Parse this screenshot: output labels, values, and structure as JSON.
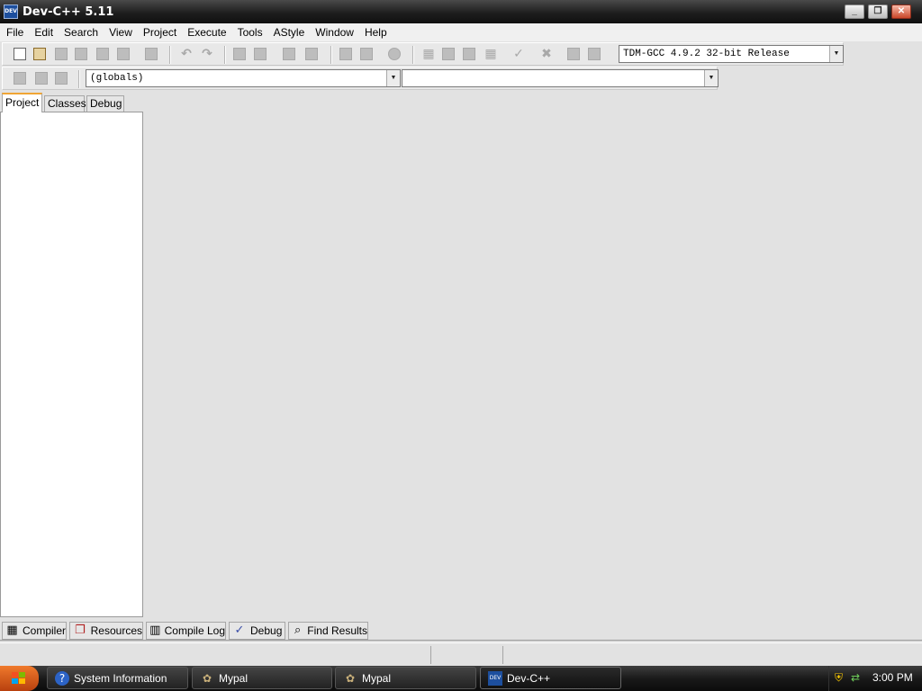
{
  "window": {
    "title": "Dev-C++ 5.11",
    "icon_text": "DEV",
    "controls": {
      "minimize": "_",
      "maximize": "❐",
      "close": "✕"
    }
  },
  "menu": [
    "File",
    "Edit",
    "Search",
    "View",
    "Project",
    "Execute",
    "Tools",
    "AStyle",
    "Window",
    "Help"
  ],
  "toolbar": {
    "compiler_selected": "TDM-GCC 4.9.2 32-bit Release",
    "scope_selected": "(globals)",
    "function_selected": ""
  },
  "project_tabs": [
    "Project",
    "Classes",
    "Debug"
  ],
  "bottom_tabs": [
    "Compiler",
    "Resources",
    "Compile Log",
    "Debug",
    "Find Results"
  ],
  "taskbar": {
    "tasks": [
      "System Information",
      "Mypal",
      "Mypal",
      "Dev-C++"
    ],
    "clock": "3:00 PM"
  },
  "colors": {
    "tab_accent": "#f0a534",
    "start_button": "#e0621f"
  }
}
